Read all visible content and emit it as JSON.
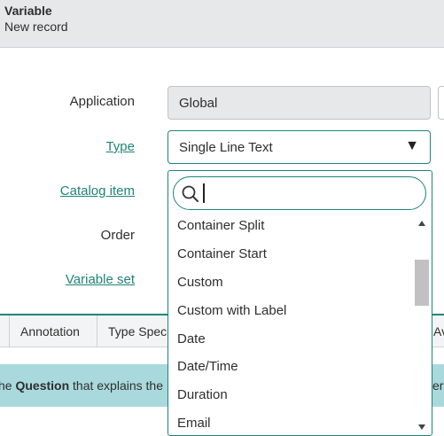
{
  "header": {
    "title": "Variable",
    "subtitle": "New record"
  },
  "form": {
    "application_label": "Application",
    "application_value": "Global",
    "type_label": "Type",
    "type_value": "Single Line Text",
    "catalog_item_label": "Catalog item",
    "order_label": "Order",
    "variable_set_label": "Variable set"
  },
  "dropdown": {
    "search_placeholder": "",
    "options": [
      "Container Split",
      "Container Start",
      "Custom",
      "Custom with Label",
      "Date",
      "Date/Time",
      "Duration",
      "Email"
    ]
  },
  "tabs": [
    "Annotation",
    "Type Spec",
    "Av"
  ],
  "info": {
    "prefix": "he ",
    "bold": "Question",
    "middle": " that explains the",
    "suffix": "eri"
  },
  "colors": {
    "accent": "#1f8476",
    "header_bg": "#e6e8ea",
    "info_bg": "#a9d9dc"
  }
}
